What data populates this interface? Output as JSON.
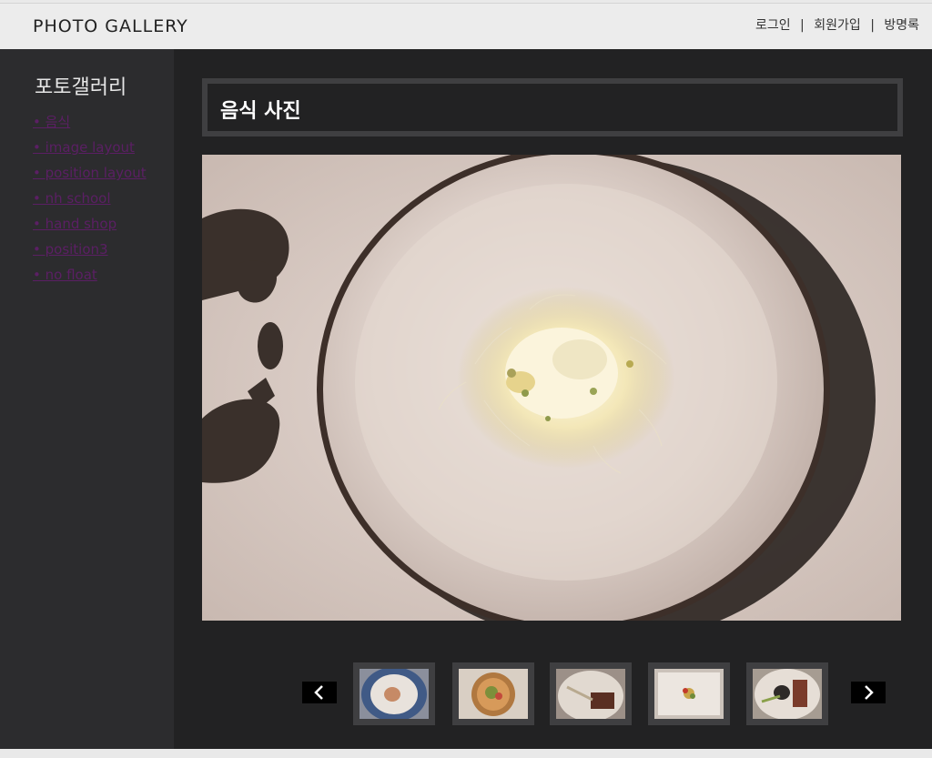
{
  "header": {
    "site_title": "PHOTO GALLERY",
    "nav": [
      "로그인",
      "회원가입",
      "방명록"
    ],
    "separator": "|"
  },
  "sidebar": {
    "title": "포토갤러리",
    "menu": [
      "• 음식",
      "• image layout",
      "• position layout",
      "• nh school",
      "• hand shop",
      "• position3",
      "• no float"
    ]
  },
  "main": {
    "title": "음식 사진",
    "main_photo_icon": "food-plate-photo",
    "prev_icon": "chevron-left-icon",
    "next_icon": "chevron-right-icon",
    "thumbnails": [
      {
        "icon": "thumbnail-dish-blue-plate"
      },
      {
        "icon": "thumbnail-dish-tart"
      },
      {
        "icon": "thumbnail-dish-meat"
      },
      {
        "icon": "thumbnail-dish-garnish"
      },
      {
        "icon": "thumbnail-dish-bone"
      }
    ]
  },
  "colors": {
    "sidebar_bg": "#2c2c2e",
    "main_bg": "#222223",
    "link": "#5b1f64",
    "frame": "#3f3f41"
  }
}
